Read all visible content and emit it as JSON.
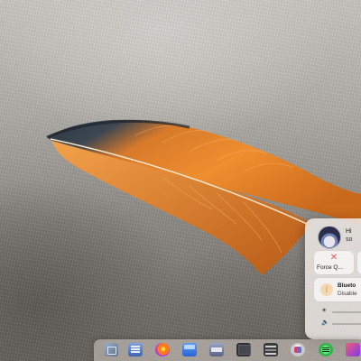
{
  "wallpaper": {
    "subject": "orange-feather-on-linen"
  },
  "control_center": {
    "profile": {
      "name": "Hi",
      "subtitle": "so",
      "avatar_icon": "user-avatar"
    },
    "force_quit": {
      "label": "Force Q...",
      "icon": "close-x-icon"
    },
    "bluetooth": {
      "title": "Blueto",
      "status": "Disable",
      "icon": "bluetooth-icon"
    },
    "brightness": {
      "icon": "sun-icon"
    },
    "volume": {
      "icon": "speaker-icon"
    }
  },
  "dock": {
    "apps": [
      {
        "name": "finder-like-app"
      },
      {
        "name": "notes-app"
      },
      {
        "name": "firefox-browser"
      },
      {
        "name": "files-app"
      },
      {
        "name": "drive-app"
      },
      {
        "name": "terminal-app"
      },
      {
        "name": "settings-app"
      },
      {
        "name": "camera-app"
      },
      {
        "name": "spotify-app"
      },
      {
        "name": "app-store"
      }
    ]
  },
  "colors": {
    "feather_orange": "#e8832a",
    "feather_dark": "#2a3440",
    "panel_bg": "#ece8e4",
    "force_quit_red": "#e05a4d"
  }
}
